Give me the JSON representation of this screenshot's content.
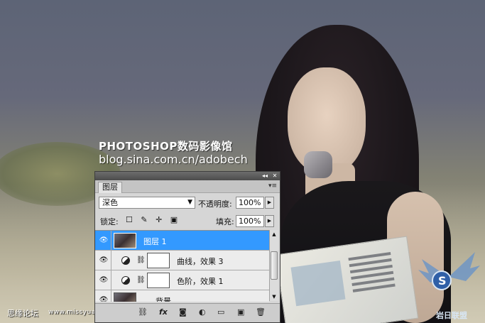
{
  "watermark": {
    "title": "PHOTOSHOP数码影像馆",
    "url": "blog.sina.com.cn/adobech"
  },
  "footer": {
    "site_name": "思缘论坛",
    "site_url": "www.missyuan.com"
  },
  "logo": {
    "text": "岩日联盟",
    "icon": "winged-s-logo"
  },
  "layers_panel": {
    "titlebar": {
      "collapse_icon": "◂◂",
      "close_icon": "✕"
    },
    "tab_label": "图层",
    "menu_icon": "▾≡",
    "blend_mode": "深色",
    "opacity_label": "不透明度:",
    "opacity_value": "100%",
    "lock_label": "锁定:",
    "lock_icons": "☐ ✎ ✛ ▣",
    "fill_label": "填充:",
    "fill_value": "100%",
    "layers": [
      {
        "name": "图层 1",
        "type": "pixel",
        "selected": true
      },
      {
        "name": "曲线，效果 3",
        "type": "adjustment"
      },
      {
        "name": "色阶，效果 1",
        "type": "adjustment"
      },
      {
        "name": "背景",
        "type": "pixel"
      }
    ],
    "bottom_icons": [
      "link-icon",
      "fx-icon",
      "mask-icon",
      "adjustment-icon",
      "folder-icon",
      "new-layer-icon",
      "trash-icon"
    ],
    "bottom_glyphs": [
      "⛓",
      "fx",
      "◙",
      "◐",
      "▭",
      "▣",
      "🗑"
    ],
    "selected_color": "#3399ff"
  }
}
